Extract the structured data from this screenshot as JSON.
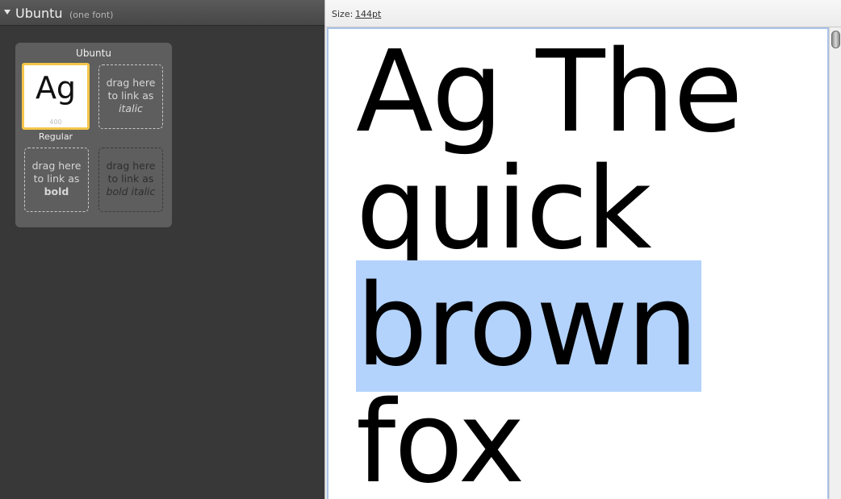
{
  "family": {
    "name": "Ubuntu",
    "count_label": "(one font)"
  },
  "card": {
    "title": "Ubuntu",
    "regular": {
      "sample": "Ag",
      "weight": "400",
      "label": "Regular"
    },
    "italic_slot": {
      "line1": "drag here",
      "line2": "to link as",
      "style": "italic"
    },
    "bold_slot": {
      "line1": "drag here",
      "line2": "to link as",
      "style": "bold"
    },
    "bold_italic_slot": {
      "line1": "drag here",
      "line2": "to link as",
      "style": "bold italic"
    }
  },
  "toolbar": {
    "size_label": "Size:",
    "size_value": "144pt"
  },
  "preview": {
    "lines": [
      "Ag The",
      "quick",
      "brown",
      "fox"
    ],
    "selected_word": "brown",
    "selection_color": "#b3d3fd"
  },
  "colors": {
    "accent_border": "#f3c64a",
    "panel_bg": "#383838"
  }
}
